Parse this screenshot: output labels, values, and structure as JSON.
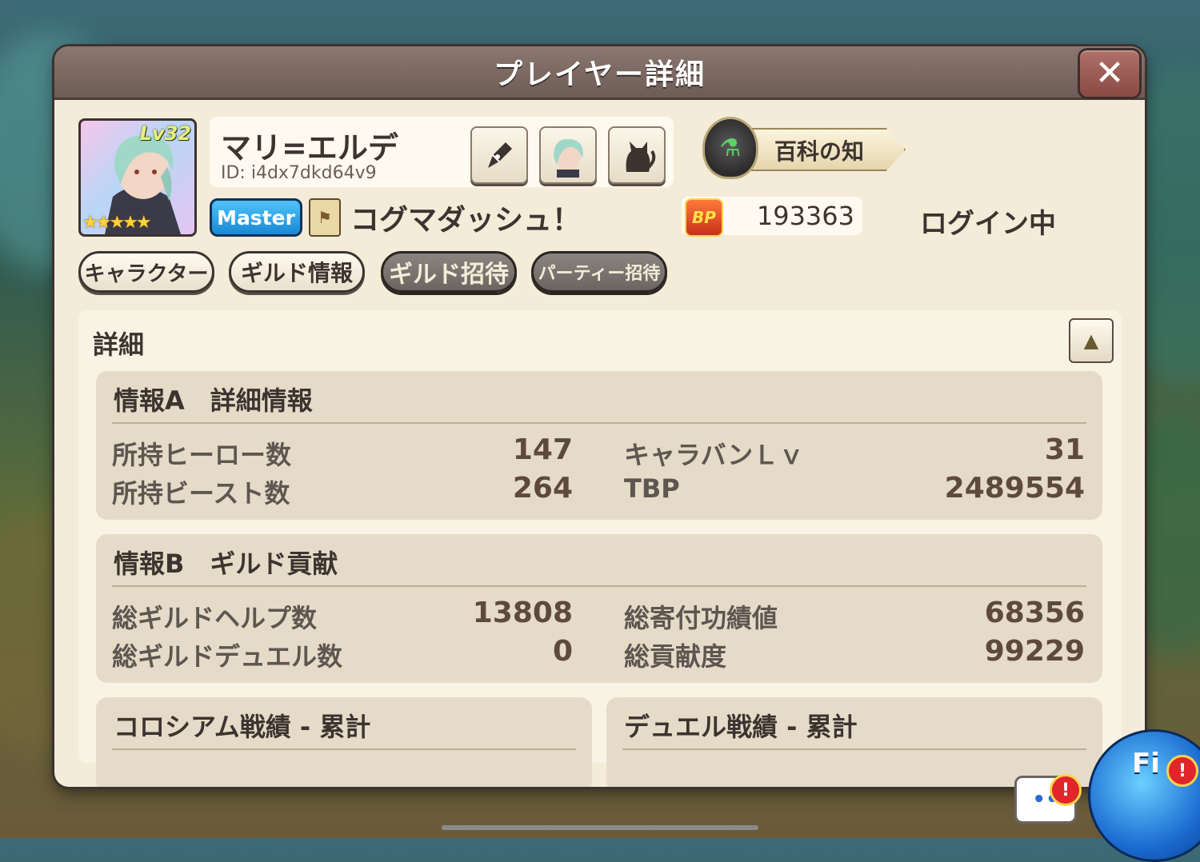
{
  "dialog": {
    "title": "プレイヤー詳細",
    "close_glyph": "✕"
  },
  "player": {
    "level": "Lv32",
    "stars": "★★★★★",
    "name": "マリ=エルデ",
    "id": "ID: i4dx7dkd64v9",
    "rank_badge": "Master",
    "guild_name": "コグマダッシュ！",
    "title_label": "百科の知",
    "bp_icon_label": "BP",
    "bp_value": "193363",
    "login_status": "ログイン中"
  },
  "actions": {
    "character": "キャラクター",
    "guild_info": "ギルド情報",
    "guild_invite": "ギルド招待",
    "party_invite": "パーティー招待"
  },
  "details": {
    "label": "詳細",
    "collapse_glyph": "▲",
    "section_a": {
      "title": "情報A　詳細情報",
      "rows": [
        {
          "label": "所持ヒーロー数",
          "value": "147"
        },
        {
          "label": "所持ビースト数",
          "value": "264"
        },
        {
          "label": "キャラバンＬｖ",
          "value": "31"
        },
        {
          "label": "TBP",
          "value": "2489554"
        }
      ]
    },
    "section_b": {
      "title": "情報B　ギルド貢献",
      "rows": [
        {
          "label": "総ギルドヘルプ数",
          "value": "13808"
        },
        {
          "label": "総ギルドデュエル数",
          "value": "0"
        },
        {
          "label": "総寄付功績値",
          "value": "68356"
        },
        {
          "label": "総貢献度",
          "value": "99229"
        }
      ]
    },
    "section_c": {
      "title": "コロシアム戦績 - 累計"
    },
    "section_d": {
      "title": "デュエル戦績 - 累計"
    }
  },
  "overlay": {
    "chat_dots": "••",
    "alert_glyph": "!",
    "mascot_label": "Fi"
  },
  "icons": {
    "edit": "pen-icon",
    "avatar": "avatar-icon",
    "beast": "cat-icon",
    "title_emblem": "potion-emblem-icon"
  }
}
